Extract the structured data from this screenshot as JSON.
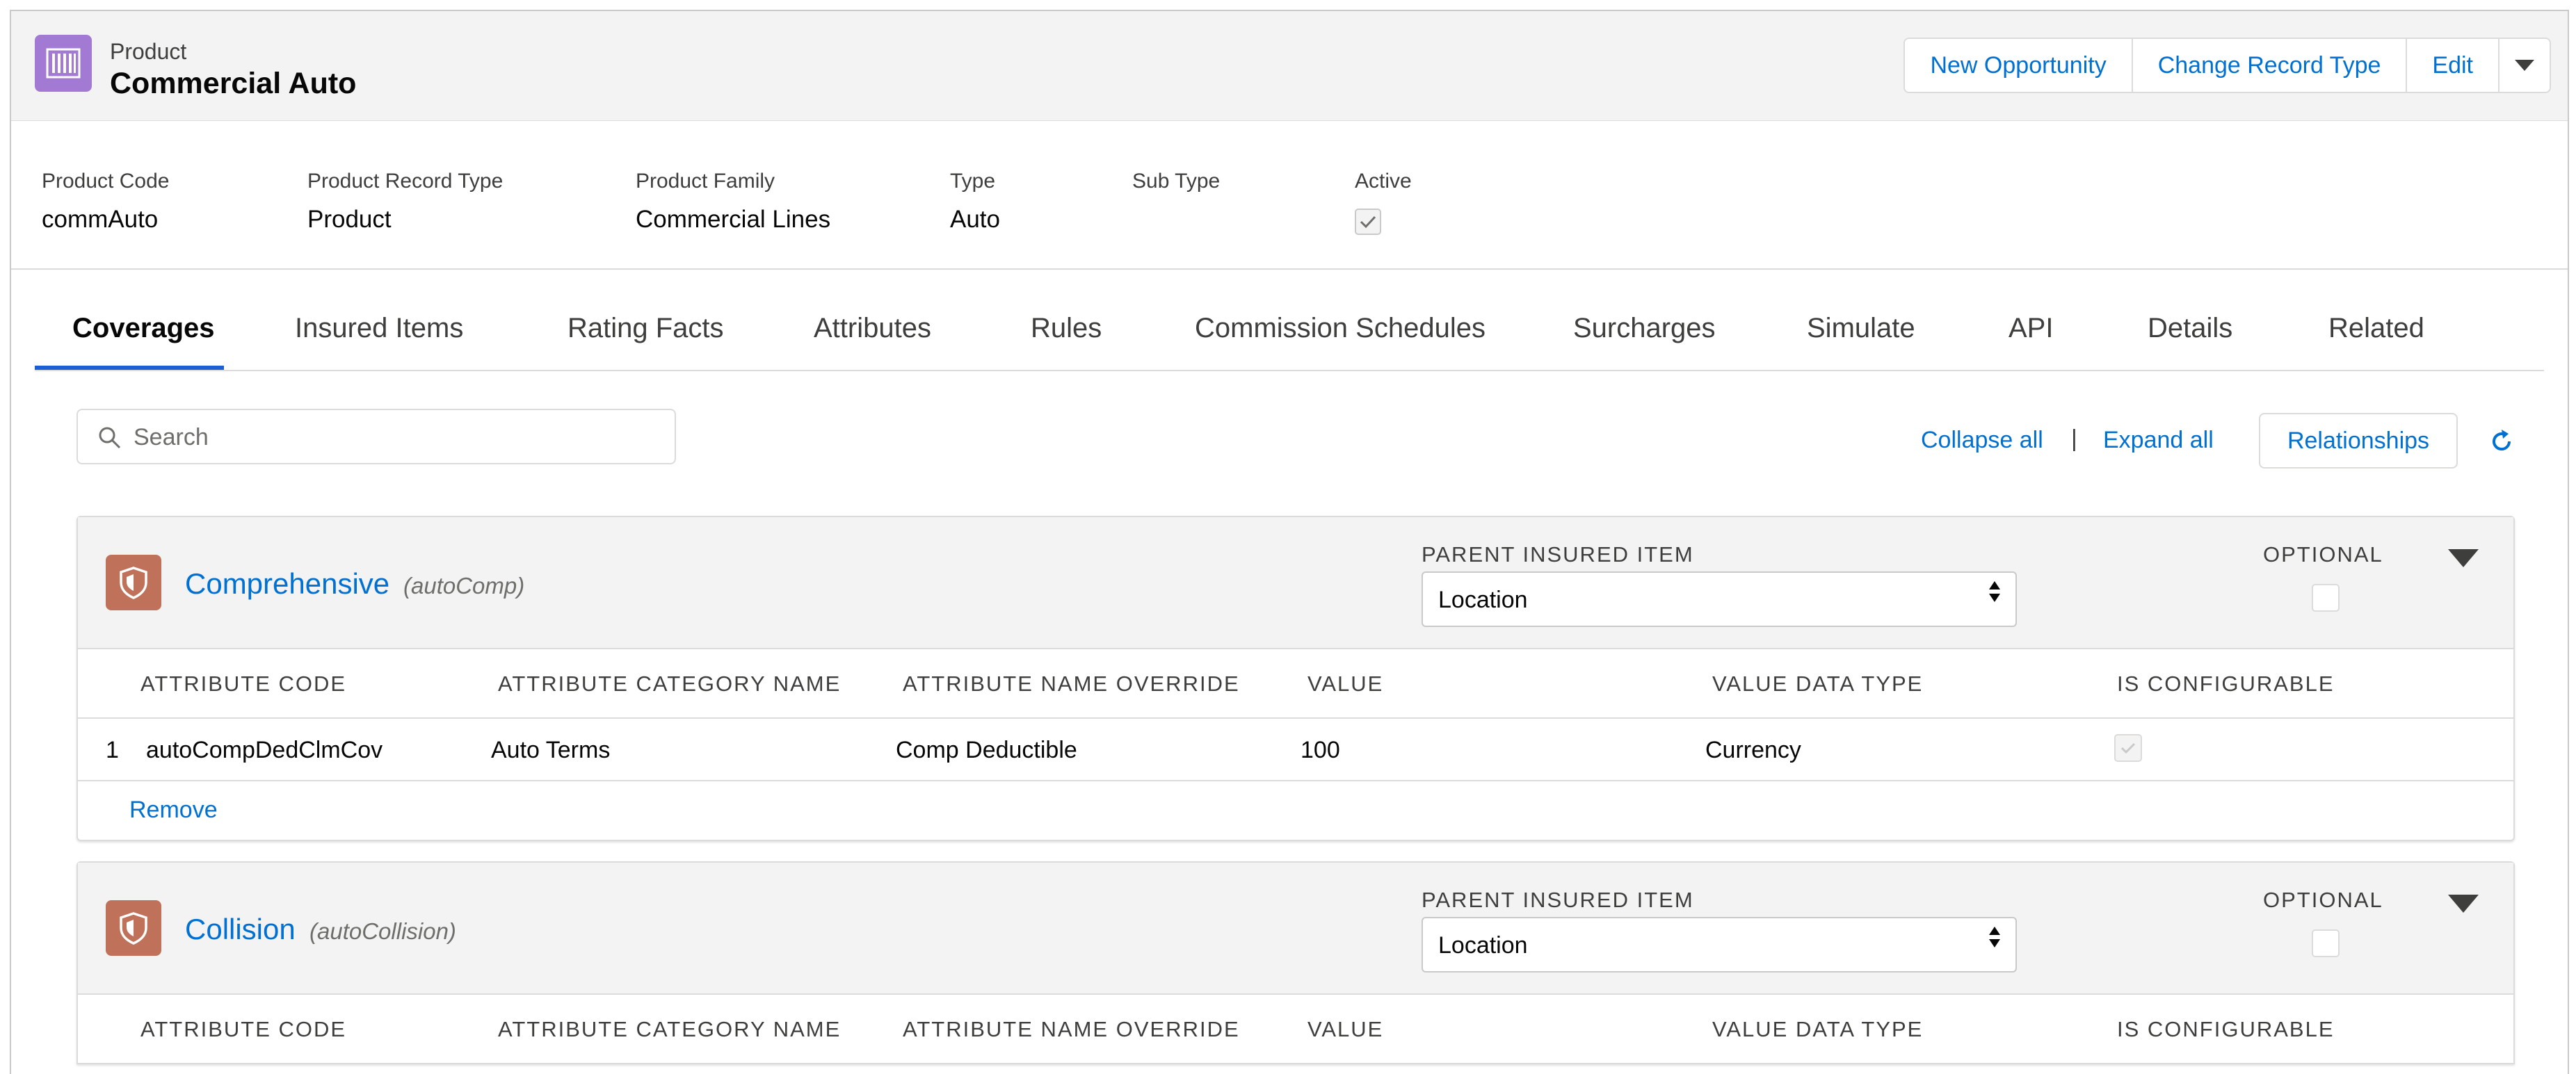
{
  "header": {
    "object_type": "Product",
    "title": "Commercial Auto",
    "actions": [
      "New Opportunity",
      "Change Record Type",
      "Edit"
    ],
    "brand_color": "#a27ad3"
  },
  "highlights": [
    {
      "label": "Product Code",
      "value": "commAuto"
    },
    {
      "label": "Product Record Type",
      "value": "Product"
    },
    {
      "label": "Product Family",
      "value": "Commercial Lines"
    },
    {
      "label": "Type",
      "value": "Auto"
    },
    {
      "label": "Sub Type",
      "value": ""
    },
    {
      "label": "Active",
      "value": "",
      "checked": true
    }
  ],
  "tabs": [
    "Coverages",
    "Insured Items",
    "Rating Facts",
    "Attributes",
    "Rules",
    "Commission Schedules",
    "Surcharges",
    "Simulate",
    "API",
    "Details",
    "Related"
  ],
  "active_tab": "Coverages",
  "toolbar": {
    "search_placeholder": "Search",
    "collapse_all": "Collapse all",
    "separator": "|",
    "expand_all": "Expand all",
    "relationships": "Relationships"
  },
  "labels": {
    "parent_insured_item": "PARENT INSURED ITEM",
    "optional": "OPTIONAL",
    "remove": "Remove"
  },
  "columns": [
    "ATTRIBUTE CODE",
    "ATTRIBUTE CATEGORY NAME",
    "ATTRIBUTE NAME OVERRIDE",
    "VALUE",
    "VALUE DATA TYPE",
    "IS CONFIGURABLE"
  ],
  "coverages": [
    {
      "name": "Comprehensive",
      "code": "(autoComp)",
      "parent_insured_item": "Location",
      "optional": false,
      "rows": [
        {
          "index": "1",
          "attribute_code": "autoCompDedClmCov",
          "category": "Auto Terms",
          "name_override": "Comp Deductible",
          "value": "100",
          "data_type": "Currency",
          "configurable": true
        }
      ]
    },
    {
      "name": "Collision",
      "code": "(autoCollision)",
      "parent_insured_item": "Location",
      "optional": false,
      "rows": []
    }
  ],
  "colors": {
    "link": "#0070d2",
    "coverage_icon": "#c0715a",
    "tab_underline": "#1b5fd5"
  }
}
